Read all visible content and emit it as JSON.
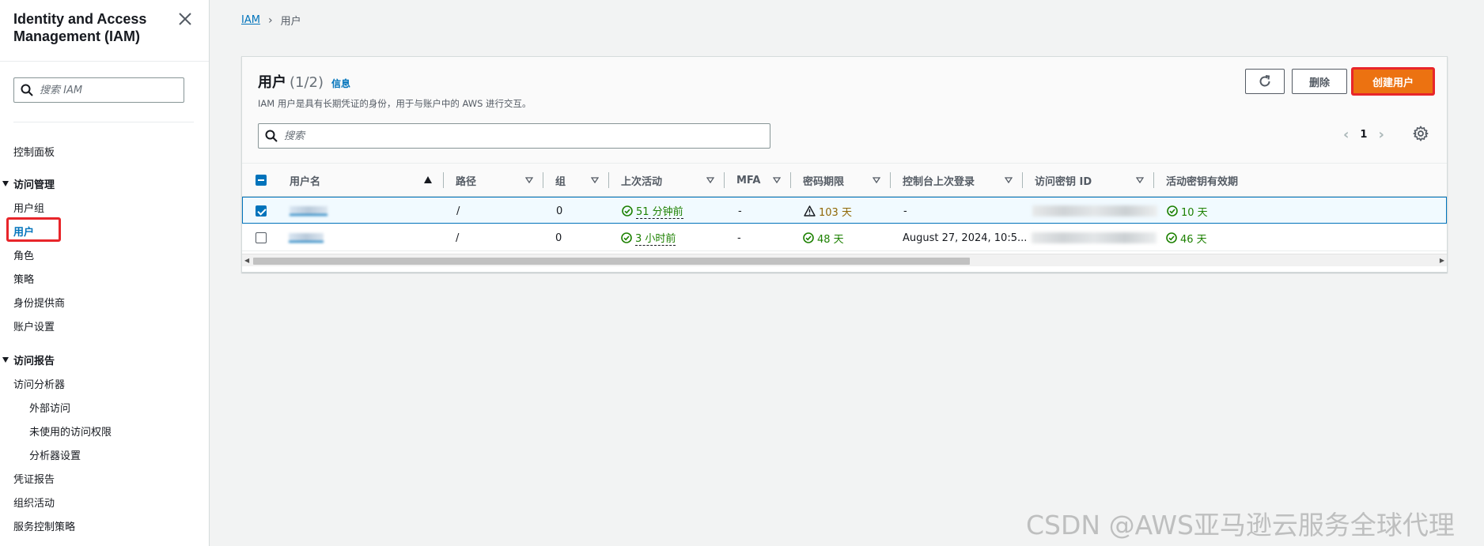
{
  "sidebar": {
    "title": "Identity and Access Management (IAM)",
    "search_placeholder": "搜索 IAM",
    "dashboard": "控制面板",
    "access_mgmt": {
      "label": "访问管理",
      "items": [
        "用户组",
        "用户",
        "角色",
        "策略",
        "身份提供商",
        "账户设置"
      ]
    },
    "access_reports": {
      "label": "访问报告",
      "analyzer": "访问分析器",
      "analyzer_items": [
        "外部访问",
        "未使用的访问权限",
        "分析器设置"
      ],
      "items": [
        "凭证报告",
        "组织活动",
        "服务控制策略"
      ]
    }
  },
  "breadcrumb": {
    "root": "IAM",
    "current": "用户"
  },
  "panel": {
    "title": "用户",
    "count": "(1/2)",
    "info": "信息",
    "description": "IAM 用户是具有长期凭证的身份，用于与账户中的 AWS 进行交互。",
    "buttons": {
      "delete": "删除",
      "create": "创建用户"
    },
    "search_placeholder": "搜索",
    "page": "1"
  },
  "table": {
    "columns": [
      "用户名",
      "路径",
      "组",
      "上次活动",
      "MFA",
      "密码期限",
      "控制台上次登录",
      "访问密钥 ID",
      "活动密钥有效期"
    ],
    "rows": [
      {
        "selected": true,
        "path": "/",
        "groups": "0",
        "last_activity": "51 分钟前",
        "mfa": "-",
        "password_age": "103 天",
        "password_status": "warning",
        "console_last_login": "-",
        "key_age": "10 天"
      },
      {
        "selected": false,
        "path": "/",
        "groups": "0",
        "last_activity": "3 小时前",
        "mfa": "-",
        "password_age": "48 天",
        "password_status": "ok",
        "console_last_login": "August 27, 2024, 10:5...",
        "key_age": "46 天"
      }
    ]
  },
  "colors": {
    "accent": "#0073bb",
    "primary_button": "#ec7211",
    "highlight": "#e8252a",
    "success": "#1d8102",
    "warning": "#906806"
  },
  "watermark": "CSDN @AWS亚马逊云服务全球代理"
}
